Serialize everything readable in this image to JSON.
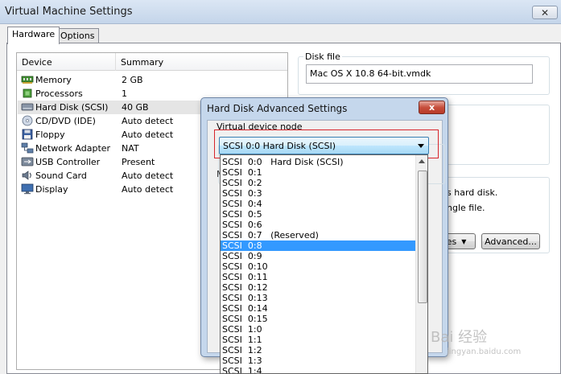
{
  "window": {
    "title": "Virtual Machine Settings",
    "close_icon": "close-icon"
  },
  "tabs": [
    {
      "label": "Hardware"
    },
    {
      "label": "Options"
    }
  ],
  "devices": {
    "col_device": "Device",
    "col_summary": "Summary",
    "rows": [
      {
        "name": "Memory",
        "summary": "2 GB",
        "icon": "memory-icon"
      },
      {
        "name": "Processors",
        "summary": "1",
        "icon": "processor-icon"
      },
      {
        "name": "Hard Disk (SCSI)",
        "summary": "40 GB",
        "icon": "hard-disk-icon",
        "selected": true
      },
      {
        "name": "CD/DVD (IDE)",
        "summary": "Auto detect",
        "icon": "cd-dvd-icon"
      },
      {
        "name": "Floppy",
        "summary": "Auto detect",
        "icon": "floppy-icon"
      },
      {
        "name": "Network Adapter",
        "summary": "NAT",
        "icon": "network-icon"
      },
      {
        "name": "USB Controller",
        "summary": "Present",
        "icon": "usb-icon"
      },
      {
        "name": "Sound Card",
        "summary": "Auto detect",
        "icon": "sound-icon"
      },
      {
        "name": "Display",
        "summary": "Auto detect",
        "icon": "display-icon"
      }
    ]
  },
  "right": {
    "disk_file_label": "Disk file",
    "disk_file_value": "Mac OS X 10.8 64-bit.vmdk",
    "text_hard_disk": "s hard disk.",
    "text_single_file": "ngle file.",
    "utilities_label": "ies",
    "advanced_label": "Advanced..."
  },
  "dialog": {
    "title": "Hard Disk Advanced Settings",
    "close_label": "x",
    "vdn_label": "Virtual device node",
    "selected_value": "SCSI  0:0   Hard Disk (SCSI)",
    "mid_fragment": "M",
    "options": [
      "SCSI  0:0   Hard Disk (SCSI)",
      "SCSI  0:1",
      "SCSI  0:2",
      "SCSI  0:3",
      "SCSI  0:4",
      "SCSI  0:5",
      "SCSI  0:6",
      "SCSI  0:7   (Reserved)",
      "SCSI  0:8",
      "SCSI  0:9",
      "SCSI  0:10",
      "SCSI  0:11",
      "SCSI  0:12",
      "SCSI  0:13",
      "SCSI  0:14",
      "SCSI  0:15",
      "SCSI  1:0",
      "SCSI  1:1",
      "SCSI  1:2",
      "SCSI  1:3",
      "SCSI  1:4"
    ],
    "highlighted_index": 8
  },
  "watermark": {
    "text1": "Bai 经验",
    "text2": "jingyan.baidu.com"
  },
  "colors": {
    "selection": "#3399ff",
    "highlight_box": "#d7262c"
  }
}
